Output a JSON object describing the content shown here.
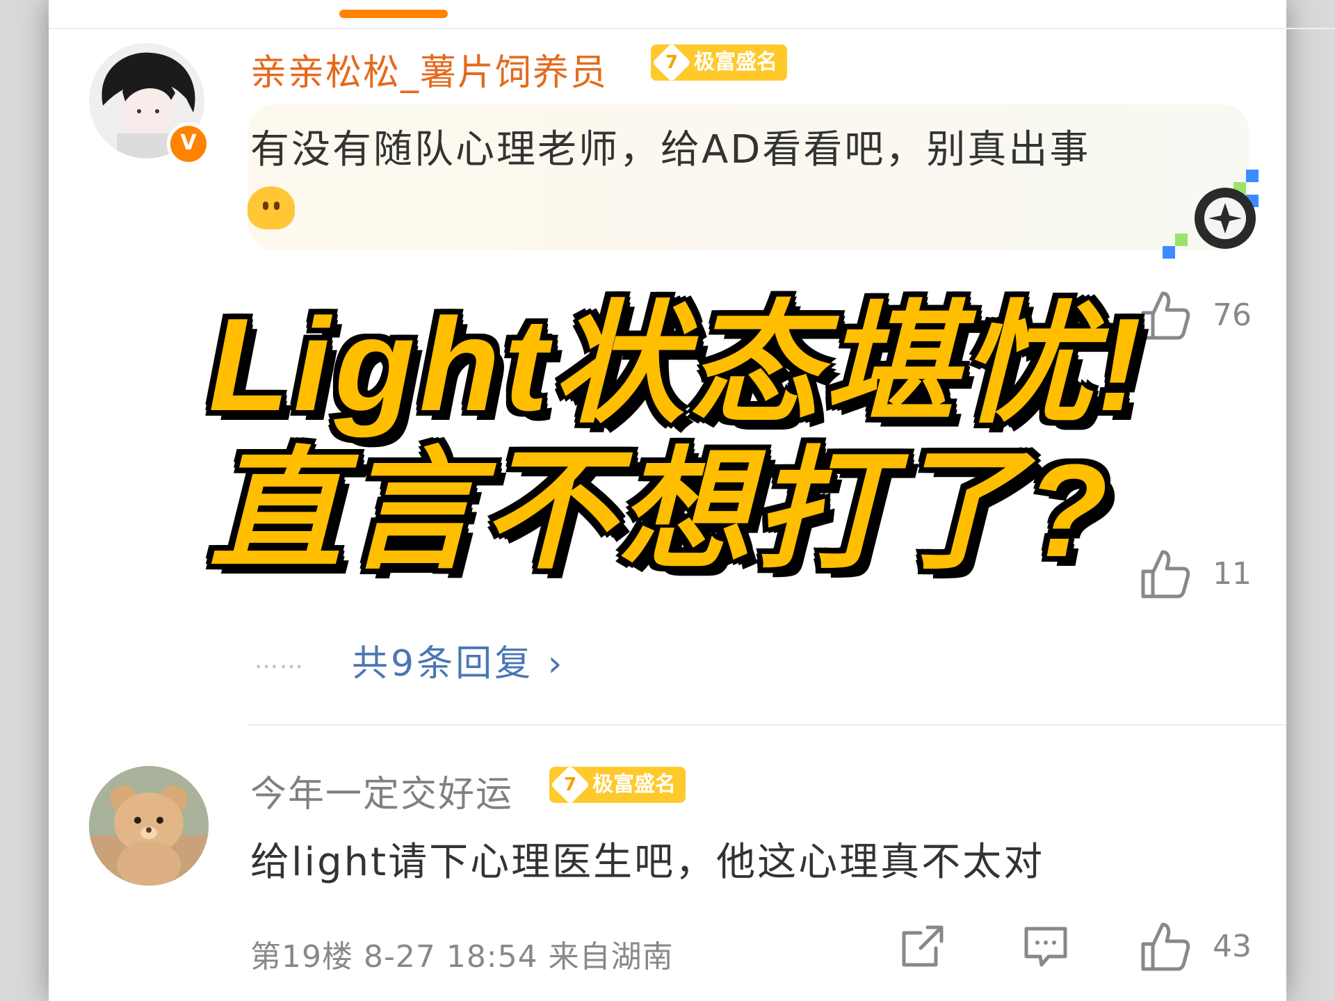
{
  "comments": [
    {
      "username": "亲亲松松_薯片饲养员",
      "fame_level": "7",
      "fame_label": "极富盛名",
      "text": "有没有随队心理老师，给AD看看吧，别真出事",
      "likes": "76",
      "verified_label": "V"
    },
    {
      "likes": "11"
    },
    {
      "username": "今年一定交好运",
      "fame_level": "7",
      "fame_label": "极富盛名",
      "text": "给light请下心理医生吧，他这心理真不太对",
      "floor_meta": "第19楼 8-27 18:54 来自湖南",
      "likes": "43"
    }
  ],
  "replies": {
    "dots": "……",
    "label": "共9条回复 ›"
  },
  "overlay": {
    "line1": "Light状态堪忧!",
    "line2": "直言不想打了?"
  },
  "colors": {
    "accent_orange": "#ff8200",
    "fame_badge": "#ffc92b",
    "overlay_yellow": "#ffbe00",
    "link_blue": "#4a77b3"
  }
}
